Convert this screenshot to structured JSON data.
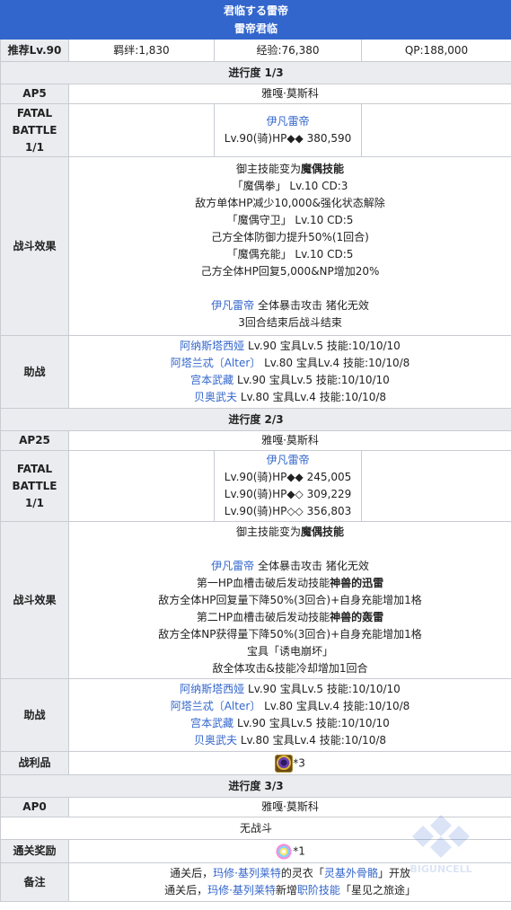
{
  "header": {
    "title": "君临する雷帝",
    "subtitle": "雷帝君临"
  },
  "recommend": {
    "label": "推荐Lv.90",
    "bond": "羁绊:1,830",
    "exp": "经验:76,380",
    "qp": "QP:188,000"
  },
  "stage1": {
    "title": "进行度 1/3",
    "ap_label": "AP5",
    "location": "雅嘎·莫斯科",
    "fatal_label": [
      "FATAL",
      "BATTLE",
      "1/1"
    ],
    "enemy_name": "伊凡雷帝",
    "enemy_stats": "Lv.90(骑)HP◆◆ 380,590",
    "effects_label": "战斗效果",
    "effects": {
      "l1a": "御主技能变为",
      "l1b": "魔偶技能",
      "l2": "「魔偶拳」 Lv.10 CD:3",
      "l3": "敌方单体HP减少10,000&强化状态解除",
      "l4": "「魔偶守卫」 Lv.10 CD:5",
      "l5": "己方全体防御力提升50%(1回合)",
      "l6": "「魔偶充能」 Lv.10 CD:5",
      "l7": "己方全体HP回复5,000&NP增加20%",
      "l8a": "伊凡雷帝",
      "l8b": " 全体暴击攻击 猪化无效",
      "l9": "3回合结束后战斗结束"
    },
    "support_label": "助战",
    "support": {
      "s1a": "阿纳斯塔西娅",
      "s1b": " Lv.90 宝具Lv.5 技能:10/10/10",
      "s2a": "阿塔兰忒〔Alter〕",
      "s2b": " Lv.80 宝具Lv.4 技能:10/10/8",
      "s3a": "宫本武藏",
      "s3b": " Lv.90 宝具Lv.5 技能:10/10/10",
      "s4a": "贝奥武夫",
      "s4b": " Lv.80 宝具Lv.4 技能:10/10/8"
    }
  },
  "stage2": {
    "title": "进行度 2/3",
    "ap_label": "AP25",
    "location": "雅嘎·莫斯科",
    "fatal_label": [
      "FATAL",
      "BATTLE",
      "1/1"
    ],
    "enemy_name": "伊凡雷帝",
    "enemy_hp1": "Lv.90(骑)HP◆◆ 245,005",
    "enemy_hp2": "Lv.90(骑)HP◆◇ 309,229",
    "enemy_hp3": "Lv.90(骑)HP◇◇ 356,803",
    "effects_label": "战斗效果",
    "effects": {
      "l1a": "御主技能变为",
      "l1b": "魔偶技能",
      "l2a": "伊凡雷帝",
      "l2b": " 全体暴击攻击 猪化无效",
      "l3a": "第一HP血槽击破后发动技能",
      "l3b": "神兽的迅雷",
      "l4": "敌方全体HP回复量下降50%(3回合)+自身充能增加1格",
      "l5a": "第二HP血槽击破后发动技能",
      "l5b": "神兽的轰雷",
      "l6": "敌方全体NP获得量下降50%(3回合)+自身充能增加1格",
      "l7": "宝具「诱电崩坏」",
      "l8": "敌全体攻击&技能冷却增加1回合"
    },
    "support_label": "助战",
    "support": {
      "s1a": "阿纳斯塔西娅",
      "s1b": " Lv.90 宝具Lv.5 技能:10/10/10",
      "s2a": "阿塔兰忒〔Alter〕",
      "s2b": " Lv.80 宝具Lv.4 技能:10/10/8",
      "s3a": "宫本武藏",
      "s3b": " Lv.90 宝具Lv.5 技能:10/10/10",
      "s4a": "贝奥武夫",
      "s4b": " Lv.80 宝具Lv.4 技能:10/10/8"
    },
    "loot_label": "战利品",
    "loot_count": "*3",
    "loot_icon": "gem-icon"
  },
  "stage3": {
    "title": "进行度 3/3",
    "ap_label": "AP0",
    "location": "雅嘎·莫斯科",
    "no_battle": "无战斗",
    "reward_label": "通关奖励",
    "reward_count": "*1",
    "reward_icon": "saint-quartz-icon",
    "notes_label": "备注",
    "notes": {
      "n1a": "通关后，",
      "n1b": "玛修·基列莱特",
      "n1c": "的灵衣「",
      "n1d": "灵基外骨骼",
      "n1e": "」开放",
      "n2a": "通关后，",
      "n2b": "玛修·基列莱特",
      "n2c": "新增",
      "n2d": "职阶技能",
      "n2e": "「星见之旅途」"
    }
  },
  "colors": {
    "header_bg": "#3366cc",
    "label_bg": "#eaecf0",
    "link": "#3366cc",
    "border": "#c8ccd1"
  }
}
